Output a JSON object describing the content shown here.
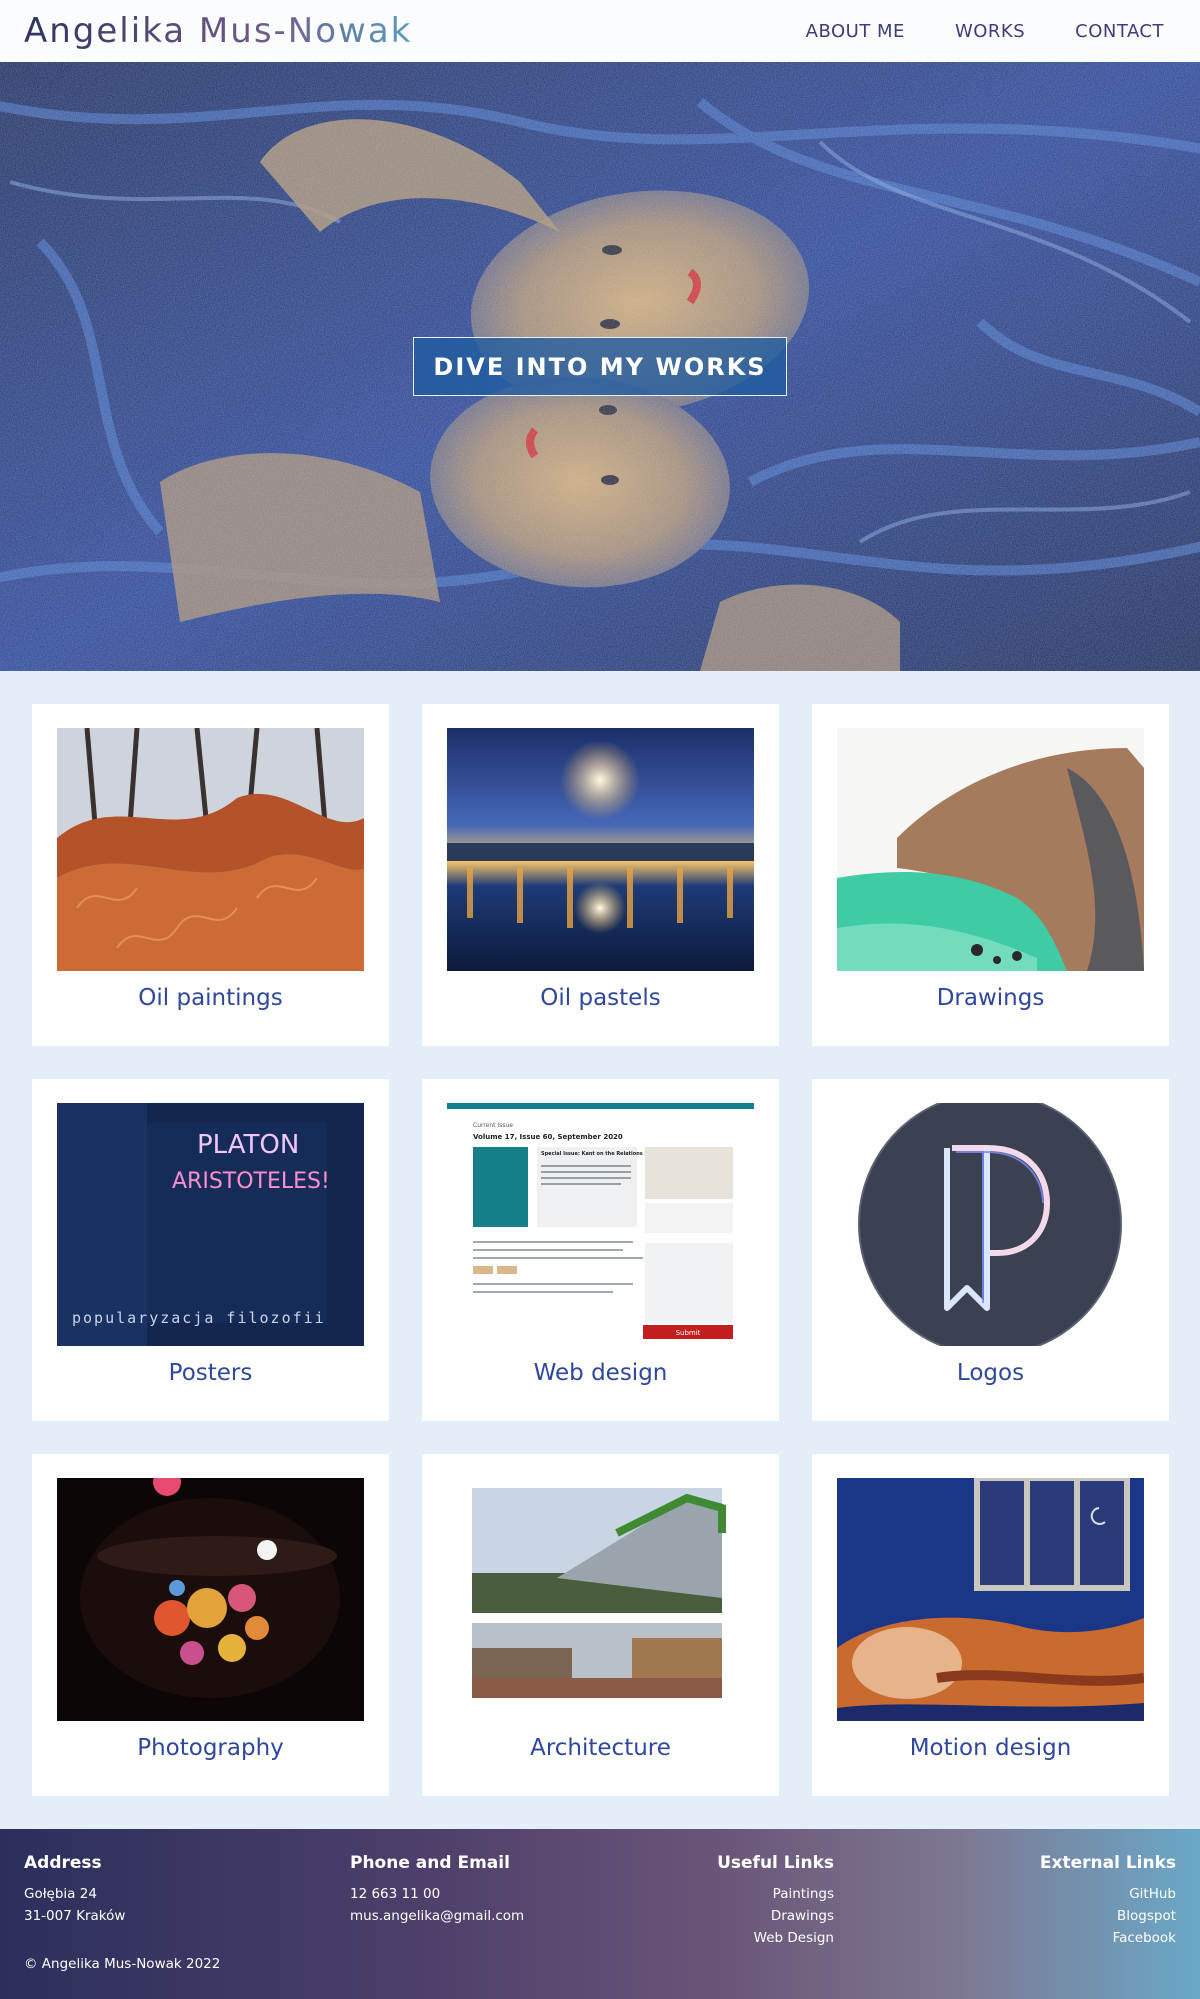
{
  "header": {
    "brand": "Angelika Mus-Nowak",
    "nav": [
      "ABOUT ME",
      "WORKS",
      "CONTACT"
    ]
  },
  "hero": {
    "button_label": "DIVE INTO MY WORKS"
  },
  "gallery": {
    "items": [
      {
        "label": "Oil paintings",
        "icon": "oil-painting-thumbnail"
      },
      {
        "label": "Oil pastels",
        "icon": "oil-pastel-thumbnail"
      },
      {
        "label": "Drawings",
        "icon": "drawing-thumbnail"
      },
      {
        "label": "Posters",
        "icon": "poster-thumbnail",
        "thumb_text": [
          "PLATON",
          "ARISTOTELES!",
          "popularyzacja filozofii"
        ]
      },
      {
        "label": "Web design",
        "icon": "web-design-thumbnail",
        "thumb_text": {
          "issue_header": "Current Issue",
          "issue": "Volume 17, Issue 60, September 2020",
          "feature_title": "Special Issue: Kant on the Relations between Church and State",
          "submit": "Submit"
        }
      },
      {
        "label": "Logos",
        "icon": "logo-thumbnail"
      },
      {
        "label": "Photography",
        "icon": "photography-thumbnail"
      },
      {
        "label": "Architecture",
        "icon": "architecture-thumbnail"
      },
      {
        "label": "Motion design",
        "icon": "motion-design-thumbnail"
      }
    ]
  },
  "footer": {
    "address": {
      "title": "Address",
      "lines": [
        "Gołębia 24",
        "31-007 Kraków"
      ]
    },
    "contact": {
      "title": "Phone and Email",
      "lines": [
        "12 663 11 00",
        "mus.angelika@gmail.com"
      ]
    },
    "useful": {
      "title": "Useful Links",
      "links": [
        "Paintings",
        "Drawings",
        "Web Design"
      ]
    },
    "external": {
      "title": "External Links",
      "links": [
        "GitHub",
        "Blogspot",
        "Facebook"
      ]
    },
    "copyright": "© Angelika Mus-Nowak 2022"
  },
  "colors": {
    "accent": "#2f479c",
    "page_bg": "#e4eef9",
    "hero_button_bg": "#205ca0"
  }
}
